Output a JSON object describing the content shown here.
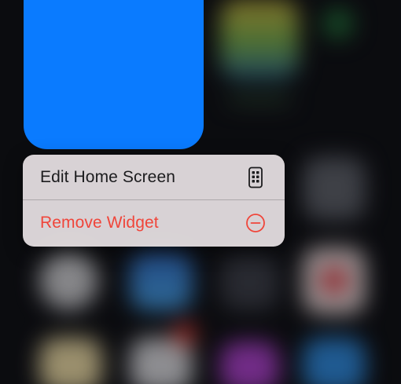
{
  "colors": {
    "widget": "#0a7bff",
    "menu_background": "#e8e2e4",
    "destructive": "#f0453a",
    "default_text": "#1c1c1e"
  },
  "widget": {
    "name": "blue-widget"
  },
  "context_menu": {
    "items": [
      {
        "label": "Edit Home Screen",
        "icon": "phone-apps-icon",
        "style": "default"
      },
      {
        "label": "Remove Widget",
        "icon": "minus-circle-icon",
        "style": "destructive"
      }
    ]
  }
}
